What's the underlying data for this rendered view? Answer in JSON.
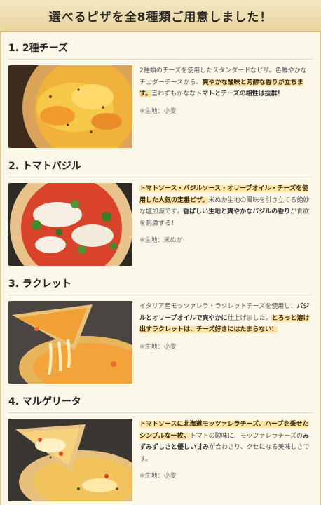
{
  "header": {
    "title": "選べるピザを全8種類ご用意しました！"
  },
  "items": [
    {
      "title": "1. 2種チーズ",
      "segments": [
        {
          "text": "2種類のチーズを使用したスタンダードなピザ。色鮮やかなチェダーチーズから、",
          "style": "normal"
        },
        {
          "text": "爽やかな酸味と芳醇な香りが立ちます。",
          "style": "hl"
        },
        {
          "text": "言わずもがなな",
          "style": "normal"
        },
        {
          "text": "トマトとチーズの相性は抜群！",
          "style": "bold"
        }
      ],
      "dough": "※生地：小麦"
    },
    {
      "title": "2. トマトバジル",
      "segments": [
        {
          "text": "トマトソース・バジルソース・オリーブオイル・チーズを使用した人気の定番ピザ。",
          "style": "hl"
        },
        {
          "text": "米ぬか生地の風味を引き立てる絶妙な塩加減です。",
          "style": "normal"
        },
        {
          "text": "香ばしい生地と爽やかなバジルの香り",
          "style": "bold"
        },
        {
          "text": "が食欲を刺激する！",
          "style": "normal"
        }
      ],
      "dough": "※生地：米ぬか"
    },
    {
      "title": "3. ラクレット",
      "segments": [
        {
          "text": "イタリア産モッツァレラ・ラクレットチーズを使用し、",
          "style": "normal"
        },
        {
          "text": "バジルとオリーブオイルで爽やかに",
          "style": "bold"
        },
        {
          "text": "仕上げました。",
          "style": "normal"
        },
        {
          "text": "とろっと溶け出すラクレットは、チーズ好きにはたまらない！",
          "style": "hl"
        }
      ],
      "dough": "※生地：小麦"
    },
    {
      "title": "4. マルゲリータ",
      "segments": [
        {
          "text": "トマトソースに北海道モッツァレラチーズ、ハーブを乗せたシンプルな一枚。",
          "style": "hl"
        },
        {
          "text": "トマトの酸味に、モッツァレラチーズの",
          "style": "normal"
        },
        {
          "text": "みずみずしさと優しい甘み",
          "style": "bold"
        },
        {
          "text": "が合わさり、クセになる美味しさです。",
          "style": "normal"
        }
      ],
      "dough": "※生地：小麦"
    }
  ]
}
